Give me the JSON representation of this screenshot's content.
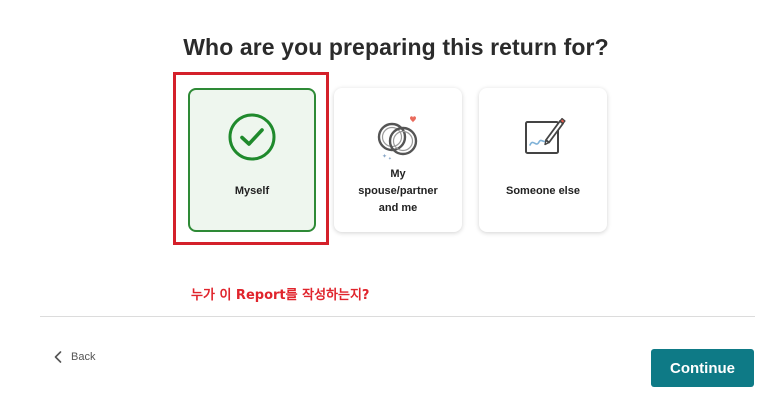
{
  "header": {
    "title": "Who are you preparing this return for?"
  },
  "options": [
    {
      "label": "Myself",
      "icon": "check-circle-icon",
      "selected": true
    },
    {
      "label_lines": [
        "My",
        "spouse/partner",
        "and me"
      ],
      "icon": "wedding-rings-icon",
      "selected": false
    },
    {
      "label": "Someone else",
      "icon": "signature-pen-icon",
      "selected": false
    }
  ],
  "annotation": {
    "text": "누가 이 Report를 작성하는지?"
  },
  "footer": {
    "back_label": "Back",
    "continue_label": "Continue"
  },
  "colors": {
    "accent": "#0e7a86",
    "selected_border": "#2e8a36",
    "selected_bg": "#eef6ee",
    "annotation": "#e0242c"
  }
}
